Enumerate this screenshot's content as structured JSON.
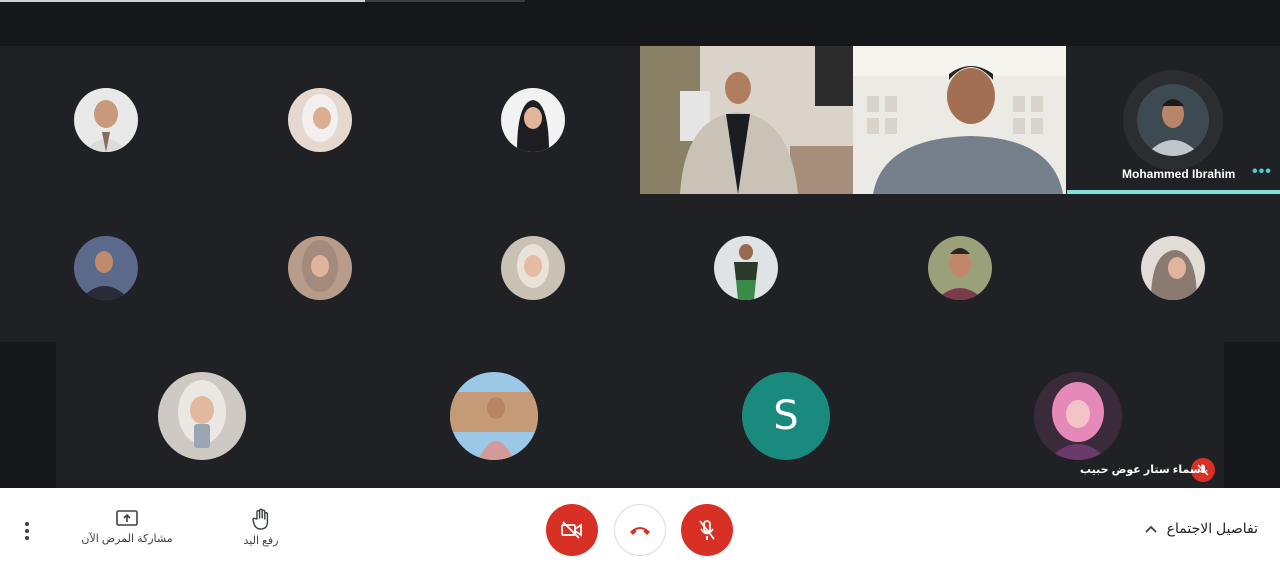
{
  "participants": {
    "pinned_name": "Mohammed Ibrahim",
    "bottom_right_name": "اسماء ستار عوض حبيب",
    "letter_avatar": "S"
  },
  "controls": {
    "present_label": "مشاركة المرض الآن",
    "raise_hand_label": "رفع اليد",
    "meeting_details_label": "تفاصيل الاجتماع"
  },
  "colors": {
    "tile_bg": "#3c4043",
    "accent_teal": "#1b8a7e",
    "speaking": "#7fe0d6",
    "danger": "#d93025"
  }
}
